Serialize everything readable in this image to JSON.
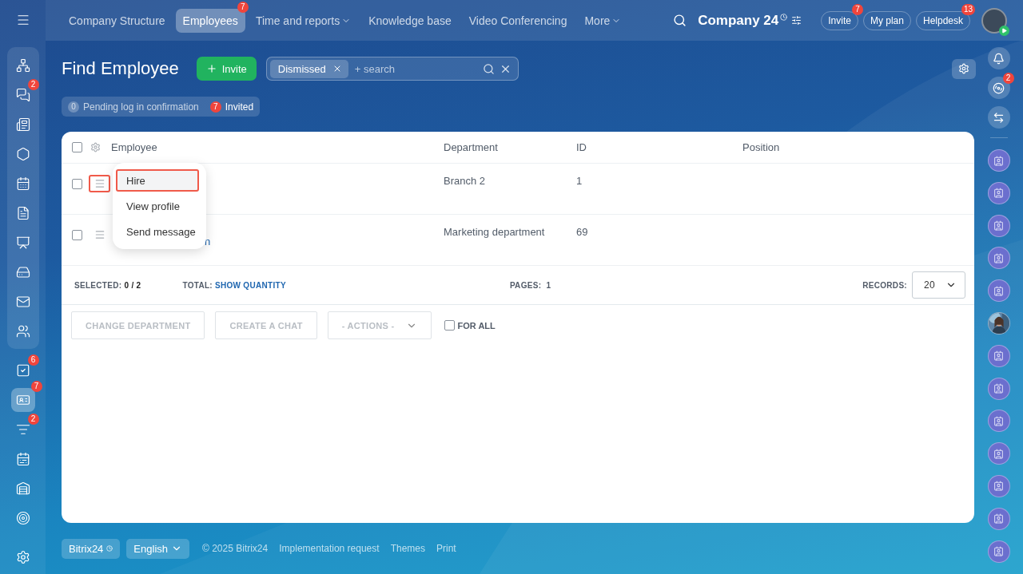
{
  "top_nav": {
    "items": [
      {
        "label": "Company Structure",
        "selected": false
      },
      {
        "label": "Employees",
        "selected": true,
        "badge": "7"
      },
      {
        "label": "Time and reports",
        "selected": false,
        "dropdown": true
      },
      {
        "label": "Knowledge base",
        "selected": false
      },
      {
        "label": "Video Conferencing",
        "selected": false
      },
      {
        "label": "More",
        "selected": false,
        "dropdown": true
      }
    ],
    "company": "Company 24",
    "buttons": [
      {
        "label": "Invite",
        "badge": "7"
      },
      {
        "label": "My plan"
      },
      {
        "label": "Helpdesk",
        "badge": "13"
      }
    ]
  },
  "left_sidebar": {
    "groups": [
      [
        {
          "selected": false
        },
        {
          "selected": false,
          "badge": "2"
        },
        {
          "selected": false
        },
        {
          "selected": false
        },
        {
          "selected": false
        },
        {
          "selected": false
        },
        {
          "selected": false
        },
        {
          "selected": false
        },
        {
          "selected": false
        },
        {
          "selected": false
        }
      ],
      [
        {
          "selected": false,
          "badge": "6"
        },
        {
          "selected": true,
          "badge": "7"
        },
        {
          "selected": false,
          "badge": "2"
        },
        {
          "selected": false
        },
        {
          "selected": false
        },
        {
          "selected": false
        }
      ]
    ]
  },
  "page": {
    "title": "Find Employee",
    "invite_button": "Invite",
    "filter": {
      "chip": "Dismissed",
      "placeholder": "+ search"
    },
    "counters": [
      {
        "count": "0",
        "label": "Pending log in confirmation",
        "kind": "zero"
      },
      {
        "count": "7",
        "label": "Invited",
        "kind": "alert"
      }
    ]
  },
  "table": {
    "select_all_checked": false,
    "columns": [
      "Employee",
      "Department",
      "ID",
      "Position"
    ],
    "rows": [
      {
        "name": "",
        "department": "Branch 2",
        "id": "1",
        "checked": false,
        "menu_highlighted": true
      },
      {
        "name": "n",
        "department": "Marketing department",
        "id": "69",
        "checked": false,
        "menu_highlighted": false
      }
    ],
    "row_menu": [
      {
        "label": "Hire",
        "highlighted": true
      },
      {
        "label": "View profile",
        "highlighted": false
      },
      {
        "label": "Send message",
        "highlighted": false
      }
    ],
    "footer": {
      "selected_label": "SELECTED:",
      "selected_value": "0 / 2",
      "total_label": "TOTAL:",
      "total_link": "SHOW QUANTITY",
      "pages_label": "PAGES:",
      "pages_value": "1",
      "records_label": "RECORDS:",
      "records_value": "20"
    },
    "actions": {
      "buttons": [
        "CHANGE DEPARTMENT",
        "CREATE A CHAT"
      ],
      "select": "- ACTIONS -",
      "for_all": {
        "label": "FOR ALL",
        "checked": false
      }
    }
  },
  "right_sidebar": {
    "copilot_badge": "2",
    "contacts": [
      {
        "kind": "contact"
      },
      {
        "kind": "contact"
      },
      {
        "kind": "contact"
      },
      {
        "kind": "contact"
      },
      {
        "kind": "contact"
      },
      {
        "kind": "picture"
      },
      {
        "kind": "contact"
      },
      {
        "kind": "contact"
      },
      {
        "kind": "contact"
      },
      {
        "kind": "contact"
      },
      {
        "kind": "contact"
      },
      {
        "kind": "contact"
      },
      {
        "kind": "contact"
      }
    ]
  },
  "footer": {
    "brand": "Bitrix24",
    "language": "English",
    "copyright": "© 2025 Bitrix24",
    "links": [
      "Implementation request",
      "Themes",
      "Print"
    ]
  }
}
